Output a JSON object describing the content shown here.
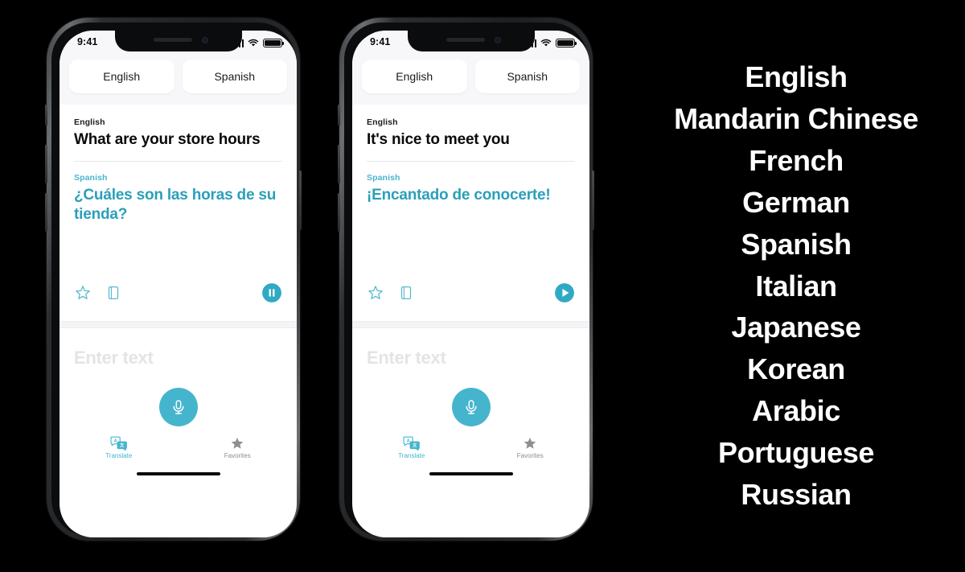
{
  "background_color": "#000000",
  "accent_color": "#45b5cd",
  "phones": [
    {
      "status_bar": {
        "time": "9:41",
        "signal_icon": "cellular-signal-icon",
        "wifi_icon": "wifi-icon",
        "battery_icon": "battery-full-icon"
      },
      "language_selector": {
        "source_button": "English",
        "target_button": "Spanish"
      },
      "card": {
        "source_label": "English",
        "source_text": "What are your store hours",
        "target_label": "Spanish",
        "target_text": "¿Cuáles son las horas de su tienda?",
        "actions": {
          "favorite_icon": "star-outline-icon",
          "dictionary_icon": "dictionary-book-icon",
          "playback_icon": "pause-circle-icon",
          "playback_state": "pause"
        }
      },
      "input": {
        "placeholder": "Enter text",
        "mic_icon": "microphone-icon"
      },
      "tabs": [
        {
          "label": "Translate",
          "icon": "translate-icon",
          "active": true
        },
        {
          "label": "Favorites",
          "icon": "star-filled-icon",
          "active": false
        }
      ]
    },
    {
      "status_bar": {
        "time": "9:41",
        "signal_icon": "cellular-signal-icon",
        "wifi_icon": "wifi-icon",
        "battery_icon": "battery-full-icon"
      },
      "language_selector": {
        "source_button": "English",
        "target_button": "Spanish"
      },
      "card": {
        "source_label": "English",
        "source_text": "It's nice to meet you",
        "target_label": "Spanish",
        "target_text": "¡Encantado de conocerte!",
        "actions": {
          "favorite_icon": "star-outline-icon",
          "dictionary_icon": "dictionary-book-icon",
          "playback_icon": "play-circle-icon",
          "playback_state": "play"
        }
      },
      "input": {
        "placeholder": "Enter text",
        "mic_icon": "microphone-icon"
      },
      "tabs": [
        {
          "label": "Translate",
          "icon": "translate-icon",
          "active": true
        },
        {
          "label": "Favorites",
          "icon": "star-filled-icon",
          "active": false
        }
      ]
    }
  ],
  "language_list": {
    "items": [
      "English",
      "Mandarin Chinese",
      "French",
      "German",
      "Spanish",
      "Italian",
      "Japanese",
      "Korean",
      "Arabic",
      "Portuguese",
      "Russian"
    ]
  }
}
